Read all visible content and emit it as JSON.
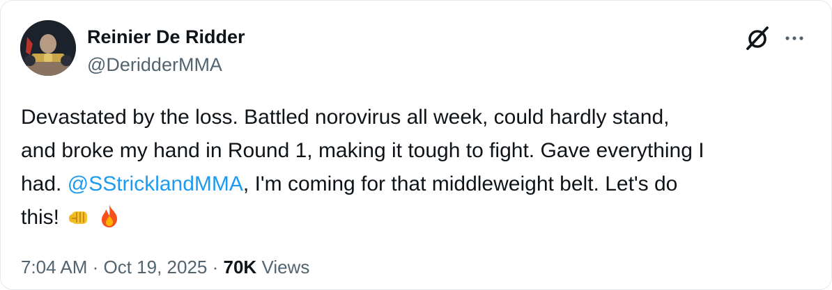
{
  "author": {
    "display_name": "Reinier De Ridder",
    "handle": "@DeridderMMA"
  },
  "header_icons": {
    "logo": "grok-logo-icon",
    "more": "more-options-icon"
  },
  "tweet": {
    "line1": "Devastated by the loss. Battled norovirus all week, could hardly stand,",
    "line2": "and broke my hand in Round 1, making it tough to fight. Gave everything I",
    "line3_before": "had. ",
    "mention": "@SStricklandMMA",
    "line3_after": ", I'm coming for that middleweight belt. Let's do",
    "line4": "this!",
    "emojis": [
      "oncoming-fist-emoji",
      "fire-emoji"
    ]
  },
  "meta": {
    "time": "7:04 AM",
    "sep1": " · ",
    "date": "Oct 19, 2025",
    "sep2": " · ",
    "views_count": "70K",
    "views_label": " Views"
  },
  "colors": {
    "text": "#0f1419",
    "secondary": "#536471",
    "link": "#1d9bf0",
    "border": "#e4e8ea"
  }
}
